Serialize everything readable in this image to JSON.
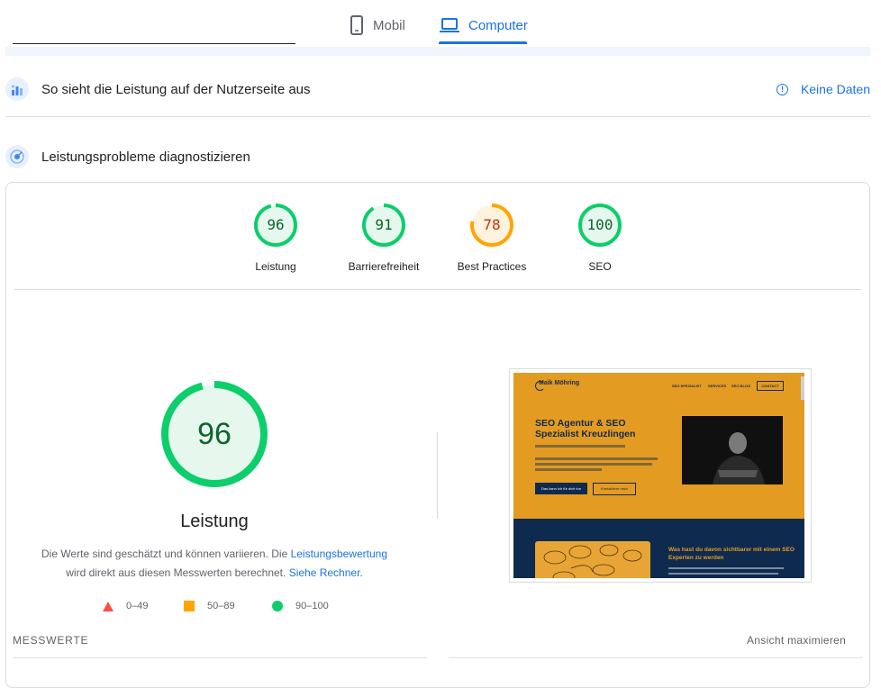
{
  "tabs": {
    "mobile_label": "Mobil",
    "desktop_label": "Computer",
    "active": "Computer",
    "active_color": "#1a73e8"
  },
  "field_data": {
    "title": "So sieht die Leistung auf der Nutzerseite aus",
    "no_data_label": "Keine Daten"
  },
  "lab_data": {
    "title": "Leistungsprobleme diagnostizieren"
  },
  "categories": [
    {
      "label": "Leistung",
      "score": 96,
      "color": "#0cce6b",
      "text_color": "#0d652d"
    },
    {
      "label": "Barrierefreiheit",
      "score": 91,
      "color": "#0cce6b",
      "text_color": "#0d652d"
    },
    {
      "label": "Best Practices",
      "score": 78,
      "color": "#ffa400",
      "text_color": "#c33300"
    },
    {
      "label": "SEO",
      "score": 100,
      "color": "#0cce6b",
      "text_color": "#0d652d"
    }
  ],
  "performance": {
    "score": 96,
    "title": "Leistung",
    "desc_part1": "Die Werte sind geschätzt und können variieren. Die ",
    "desc_link1": "Leistungsbewertung",
    "desc_part2": "wird direkt aus diesen Messwerten berechnet. ",
    "desc_link2": "Siehe Rechner",
    "desc_end": "."
  },
  "legend": [
    {
      "range": "0–49",
      "shape": "triangle",
      "color": "#ff4e42"
    },
    {
      "range": "50–89",
      "shape": "square",
      "color": "#ffa400"
    },
    {
      "range": "90–100",
      "shape": "circle",
      "color": "#0cce6b"
    }
  ],
  "screenshot": {
    "logo": "Maik Möhring",
    "nav": [
      "SEO SPEZIALIST",
      "SERVICES",
      "SEO BLOG"
    ],
    "contact": "CONTACT",
    "headline": "SEO Agentur & SEO Spezialist Kreuzlingen",
    "btn_primary": "Das kann ich für dich tun",
    "btn_secondary": "Kontaktiere mich",
    "section_headline": "Was hast du davon sichtbarer mit einem SEO Experten zu werden",
    "brand_color": "#e39b22",
    "dark_color": "#0e2a4f"
  },
  "footer": {
    "metrics_label": "MESSWERTE",
    "expand_label": "Ansicht maximieren"
  }
}
